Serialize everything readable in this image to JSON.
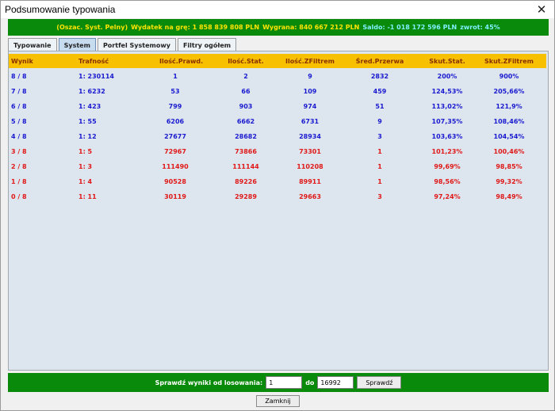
{
  "window": {
    "title": "Podsumowanie typowania",
    "close_glyph": "✕"
  },
  "summary": {
    "system": "(Oszac. Syst. Pelny)",
    "expense": "Wydatek na grę: 1 858 839 808 PLN",
    "winnings": "Wygrana: 840 667 212 PLN",
    "balance": "Saldo: -1 018 172 596 PLN",
    "return": "zwrot: 45%"
  },
  "tabs": [
    {
      "label": "Typowanie",
      "active": false
    },
    {
      "label": "System",
      "active": true
    },
    {
      "label": "Portfel Systemowy",
      "active": false
    },
    {
      "label": "Filtry ogółem",
      "active": false
    }
  ],
  "table": {
    "headers": [
      "Wynik",
      "Trafność",
      "Ilość.Prawd.",
      "Ilość.Stat.",
      "Ilość.ZFiltrem",
      "Śred.Przerwa",
      "Skut.Stat.",
      "Skut.ZFiltrem"
    ],
    "rows": [
      [
        "8 / 8",
        "1: 230114",
        "1",
        "2",
        "9",
        "2832",
        "200%",
        "900%"
      ],
      [
        "7 / 8",
        "1: 6232",
        "53",
        "66",
        "109",
        "459",
        "124,53%",
        "205,66%"
      ],
      [
        "6 / 8",
        "1: 423",
        "799",
        "903",
        "974",
        "51",
        "113,02%",
        "121,9%"
      ],
      [
        "5 / 8",
        "1: 55",
        "6206",
        "6662",
        "6731",
        "9",
        "107,35%",
        "108,46%"
      ],
      [
        "4 / 8",
        "1: 12",
        "27677",
        "28682",
        "28934",
        "3",
        "103,63%",
        "104,54%"
      ],
      [
        "3 / 8",
        "1: 5",
        "72967",
        "73866",
        "73301",
        "1",
        "101,23%",
        "100,46%"
      ],
      [
        "2 / 8",
        "1: 3",
        "111490",
        "111144",
        "110208",
        "1",
        "99,69%",
        "98,85%"
      ],
      [
        "1 / 8",
        "1: 4",
        "90528",
        "89226",
        "89911",
        "1",
        "98,56%",
        "99,32%"
      ],
      [
        "0 / 8",
        "1: 11",
        "30119",
        "29289",
        "29663",
        "3",
        "97,24%",
        "98,49%"
      ]
    ],
    "row_colors": [
      "#1a1ad0",
      "#1a1ad0",
      "#1a1ad0",
      "#1a1ad0",
      "#1a1ad0",
      "#e01818",
      "#e01818",
      "#e01818",
      "#e01818"
    ]
  },
  "bottom": {
    "label": "Sprawdź wyniki od losowania:",
    "from_value": "1",
    "to_label": "do",
    "to_value": "16992",
    "check_button": "Sprawdź"
  },
  "close_button": "Zamknij",
  "colors": {
    "summary_bg": "#0a8a0a",
    "header_bg": "#f7c000",
    "panel_bg": "#dde6ee"
  }
}
